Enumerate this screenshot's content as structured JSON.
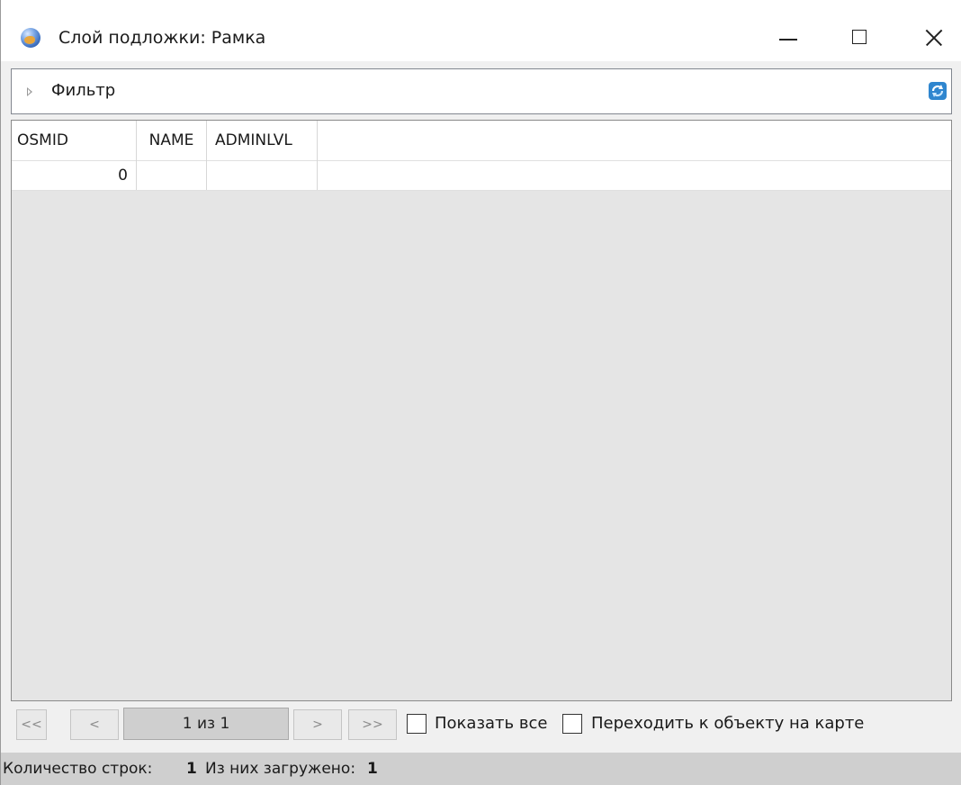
{
  "window": {
    "title": "Слой подложки: Рамка",
    "icon": "globe-icon",
    "controls": [
      "minimize-icon",
      "maximize-icon",
      "close-icon"
    ]
  },
  "filter": {
    "label": "Фильтр",
    "refresh_icon": "refresh-icon"
  },
  "grid": {
    "columns": [
      "OSMID",
      "NAME",
      "ADMINLVL"
    ],
    "rows": [
      {
        "OSMID": "0",
        "NAME": "",
        "ADMINLVL": ""
      }
    ]
  },
  "pager": {
    "first_label": "<<",
    "prev_label": "<",
    "page_text": "1 из 1",
    "next_label": ">",
    "last_label": ">>",
    "show_all_label": "Показать все",
    "show_all_checked": false,
    "goto_object_label": "Переходить к объекту на карте",
    "goto_object_checked": false
  },
  "status": {
    "rows_label": "Количество строк:",
    "rows_value": "1",
    "loaded_label": "Из них загружено:",
    "loaded_value": "1"
  },
  "colors": {
    "title_bg": "#ffffff",
    "grid_empty_bg": "#e5e5e5",
    "status_bg": "#cfcfcf",
    "page_indicator_bg": "#cfcfcf"
  }
}
